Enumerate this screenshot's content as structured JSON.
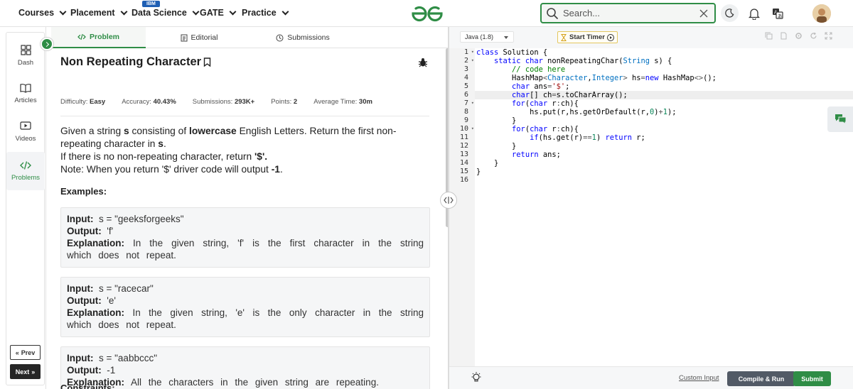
{
  "nav": {
    "items": [
      {
        "label": "Courses"
      },
      {
        "label": "Placement"
      },
      {
        "label": "Data Science",
        "badge": "IBM"
      },
      {
        "label": "GATE"
      },
      {
        "label": "Practice"
      }
    ],
    "search_placeholder": "Search...",
    "brand_color": "#2f8d46"
  },
  "sidebar": {
    "items": [
      {
        "label": "Dash",
        "icon": "dashboard-icon"
      },
      {
        "label": "Articles",
        "icon": "book-icon"
      },
      {
        "label": "Videos",
        "icon": "video-icon"
      },
      {
        "label": "Problems",
        "icon": "code-icon",
        "active": true
      }
    ],
    "prev_label": "Prev",
    "next_label": "Next"
  },
  "problem_tabs": [
    {
      "label": "Problem",
      "active": true
    },
    {
      "label": "Editorial"
    },
    {
      "label": "Submissions"
    }
  ],
  "problem": {
    "title": "Non Repeating Character",
    "meta": {
      "difficulty_label": "Difficulty:",
      "difficulty": "Easy",
      "accuracy_label": "Accuracy:",
      "accuracy": "40.43%",
      "submissions_label": "Submissions:",
      "submissions": "293K+",
      "points_label": "Points:",
      "points": "2",
      "time_label": "Average Time:",
      "time": "30m"
    },
    "desc": {
      "p1_a": "Given a string ",
      "p1_b": "s",
      "p1_c": " consisting of ",
      "p1_d": "lowercase",
      "p1_e": " English Letters. Return the first non-repeating character in ",
      "p1_f": "s",
      "p1_g": ".",
      "p2_a": "If there is no non-repeating character, return ",
      "p2_b": "'$'.",
      "p3_a": "Note: When you return '$' driver code will output ",
      "p3_b": "-1",
      "p3_c": "."
    },
    "examples_heading": "Examples:",
    "input_label": "Input:",
    "output_label": "Output:",
    "explanation_label": "Explanation:",
    "examples": [
      {
        "input": "s = \"geeksforgeeks\"",
        "output": "'f'",
        "explanation": "In the given string, 'f' is the first character in the string which does not repeat."
      },
      {
        "input": "s = \"racecar\"",
        "output": "'e'",
        "explanation": "In the given string, 'e' is the only character in the string which does not repeat."
      },
      {
        "input": "s = \"aabbccc\"",
        "output": "-1",
        "explanation": "All the characters in the given string are repeating."
      }
    ],
    "constraints_heading": "Constraints:"
  },
  "editor": {
    "language": "Java (1.8)",
    "timer_label": "Start Timer",
    "highlighted_line": 6,
    "line_numbers": [
      "1",
      "2",
      "3",
      "4",
      "5",
      "6",
      "7",
      "8",
      "9",
      "10",
      "11",
      "12",
      "13",
      "14",
      "15",
      "16"
    ],
    "custom_input": "Custom Input",
    "compile_label": "Compile & Run",
    "submit_label": "Submit"
  }
}
